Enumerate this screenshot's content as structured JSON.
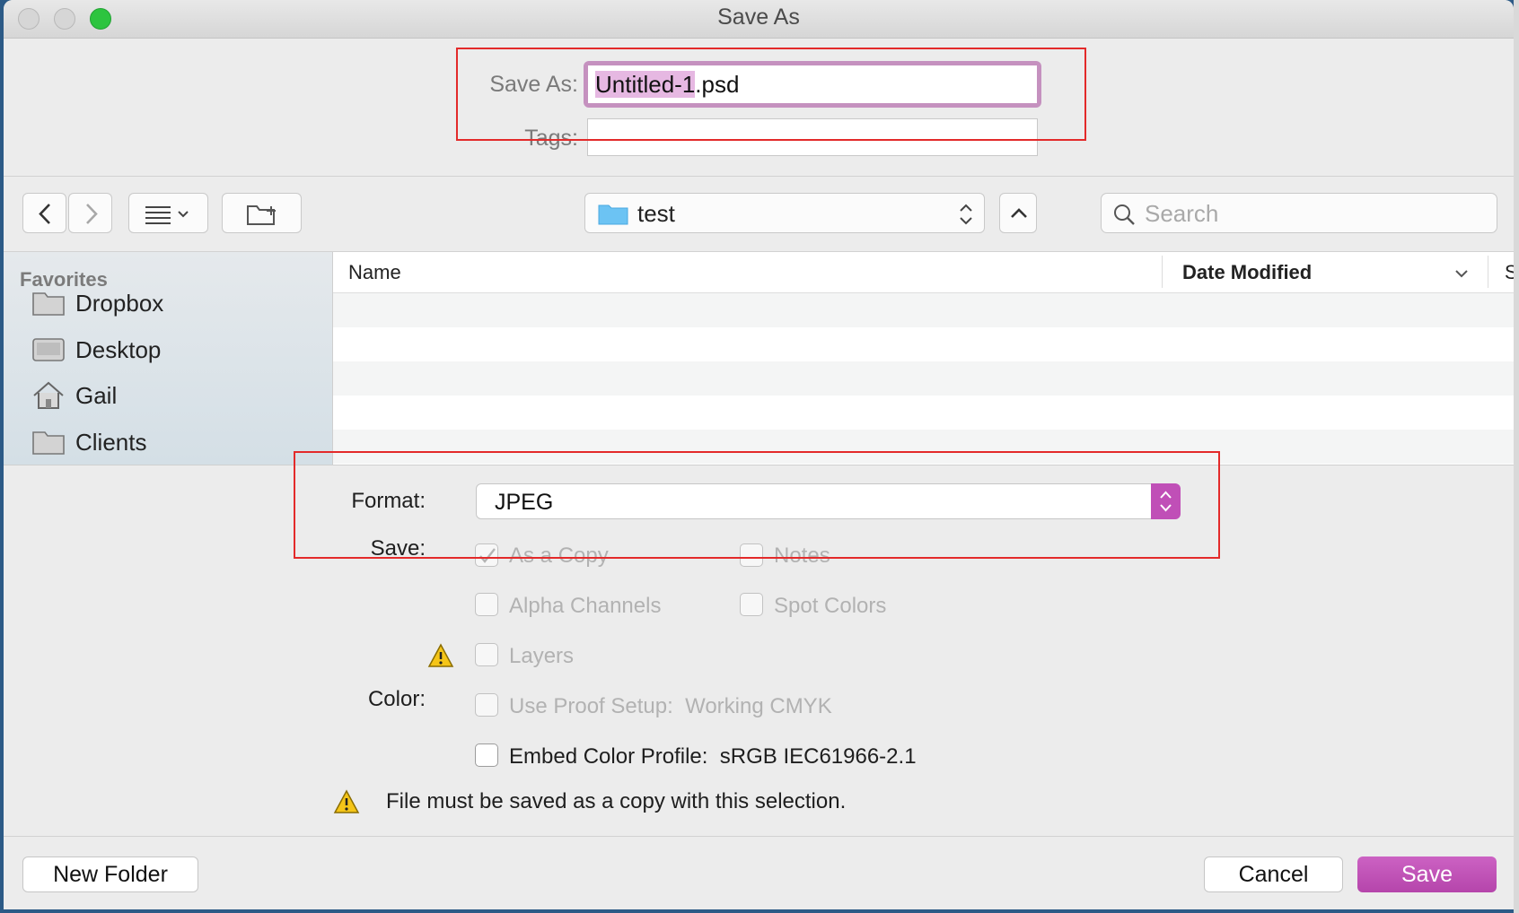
{
  "window": {
    "title": "Save As"
  },
  "file": {
    "save_as_label": "Save As:",
    "filename_selected": "Untitled-1",
    "filename_ext": ".psd",
    "tags_label": "Tags:",
    "tags_value": ""
  },
  "toolbar": {
    "location": "test",
    "search_placeholder": "Search"
  },
  "sidebar": {
    "section": "Favorites",
    "items": [
      {
        "label": "Dropbox",
        "icon": "folder-icon"
      },
      {
        "label": "Desktop",
        "icon": "desktop-icon"
      },
      {
        "label": "Gail",
        "icon": "home-icon"
      },
      {
        "label": "Clients",
        "icon": "folder-icon"
      }
    ]
  },
  "columns": {
    "name": "Name",
    "date_modified": "Date Modified",
    "size_partial": "S"
  },
  "options": {
    "format_label": "Format:",
    "format_value": "JPEG",
    "save_label": "Save:",
    "as_a_copy": "As a Copy",
    "notes": "Notes",
    "alpha_channels": "Alpha Channels",
    "spot_colors": "Spot Colors",
    "layers": "Layers",
    "color_label": "Color:",
    "use_proof_setup": "Use Proof Setup:  Working CMYK",
    "embed_color_profile": "Embed Color Profile:  sRGB IEC61966-2.1",
    "warning": "File must be saved as a copy with this selection."
  },
  "buttons": {
    "new_folder": "New Folder",
    "cancel": "Cancel",
    "save": "Save"
  },
  "colors": {
    "accent": "#c04fb7",
    "highlight": "#e6b8e2",
    "annotation": "#e32a2a",
    "warning": "#f5c518"
  }
}
